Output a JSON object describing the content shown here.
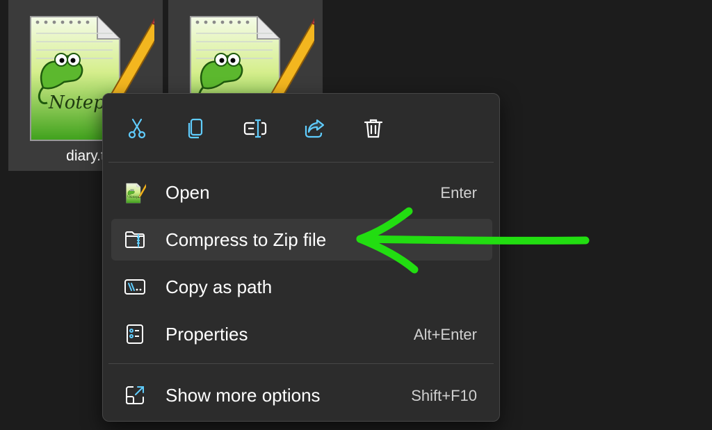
{
  "files": [
    {
      "name": "diary.t",
      "icon": "notepad-plus-plus-icon"
    },
    {
      "name": "",
      "icon": "notepad-plus-plus-icon"
    }
  ],
  "toolbar": {
    "items": [
      {
        "icon": "cut-icon"
      },
      {
        "icon": "copy-icon"
      },
      {
        "icon": "rename-icon"
      },
      {
        "icon": "share-icon"
      },
      {
        "icon": "delete-icon"
      }
    ]
  },
  "menu": {
    "items": [
      {
        "label": "Open",
        "shortcut": "Enter",
        "icon": "notepad-plus-plus-icon"
      },
      {
        "label": "Compress to Zip file",
        "shortcut": "",
        "icon": "zip-folder-icon",
        "highlighted": true
      },
      {
        "label": "Copy as path",
        "shortcut": "",
        "icon": "copy-path-icon"
      },
      {
        "label": "Properties",
        "shortcut": "Alt+Enter",
        "icon": "properties-icon"
      },
      {
        "label": "Show more options",
        "shortcut": "Shift+F10",
        "icon": "show-more-icon"
      }
    ]
  },
  "colors": {
    "background": "#1c1c1c",
    "menu_background": "#2c2c2c",
    "accent_icon": "#60cdff",
    "annotation_arrow": "#22dd11"
  }
}
